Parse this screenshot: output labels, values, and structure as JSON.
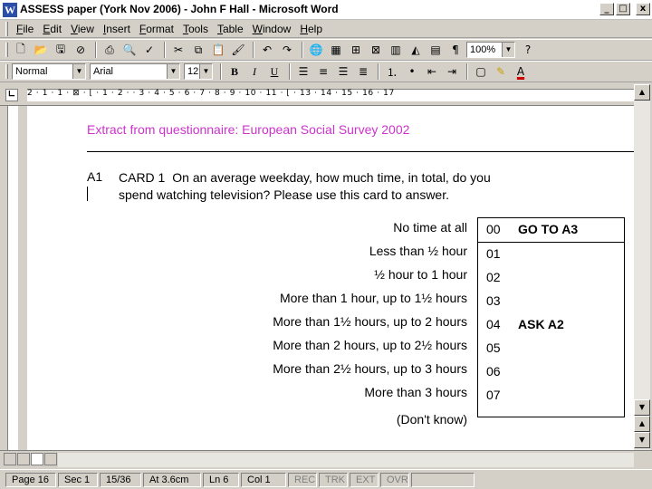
{
  "window": {
    "title": "ASSESS paper (York Nov 2006) - John F Hall - Microsoft Word",
    "app_icon": "W",
    "controls": [
      "_",
      "□",
      "x"
    ]
  },
  "menu": [
    "File",
    "Edit",
    "View",
    "Insert",
    "Format",
    "Tools",
    "Table",
    "Window",
    "Help"
  ],
  "toolbar_standard": {
    "zoom": "100%",
    "icons": [
      "new-document-icon",
      "open-folder-icon",
      "save-icon",
      "permission-icon",
      "print-icon",
      "print-preview-icon",
      "spelling-icon",
      "cut-icon",
      "copy-icon",
      "paste-icon",
      "format-painter-icon",
      "undo-icon",
      "redo-icon",
      "hyperlink-icon",
      "tables-borders-icon",
      "insert-table-icon",
      "insert-excel-icon",
      "columns-icon",
      "drawing-icon",
      "document-map-icon",
      "show-formatting-icon",
      "help-icon"
    ]
  },
  "toolbar_formatting": {
    "style": "Normal",
    "font": "Arial",
    "size": "12",
    "bold": "B",
    "italic": "I",
    "underline": "U"
  },
  "ruler": {
    "labels": "2 · 1 · 1 · ⊠ · ⌊ · 1 · 2 · · 3 · 4 · 5 · 6 · 7 · 8 · 9 · 10 · 11 · ⌊ · 13 · 14 · 15 · 16 · 17"
  },
  "document": {
    "heading": "Extract from questionnaire: European Social Survey 2002",
    "question_number": "A1",
    "card_label": "CARD 1",
    "question_text": "On an average weekday, how much time, in total, do you spend watching television? Please use this card to answer.",
    "answers": [
      {
        "label": "No time at all",
        "code": "00",
        "instruction": "GO TO A3"
      },
      {
        "label": "Less than ½ hour",
        "code": "01",
        "instruction": ""
      },
      {
        "label": "½ hour to 1 hour",
        "code": "02",
        "instruction": ""
      },
      {
        "label": "More than 1 hour, up to 1½ hours",
        "code": "03",
        "instruction": ""
      },
      {
        "label": "More than 1½ hours, up to 2 hours",
        "code": "04",
        "instruction": "ASK A2"
      },
      {
        "label": "More than 2 hours, up to 2½ hours",
        "code": "05",
        "instruction": ""
      },
      {
        "label": "More than 2½ hours, up to 3 hours",
        "code": "06",
        "instruction": ""
      },
      {
        "label": "More than 3 hours",
        "code": "07",
        "instruction": ""
      }
    ],
    "dont_know": "(Don't know)"
  },
  "statusbar": {
    "page": "Page 16",
    "section": "Sec 1",
    "pages": "15/36",
    "at": "At 3.6cm",
    "line": "Ln 6",
    "col": "Col 1",
    "rec": "REC",
    "trk": "TRK",
    "ext": "EXT",
    "ovr": "OVR"
  }
}
